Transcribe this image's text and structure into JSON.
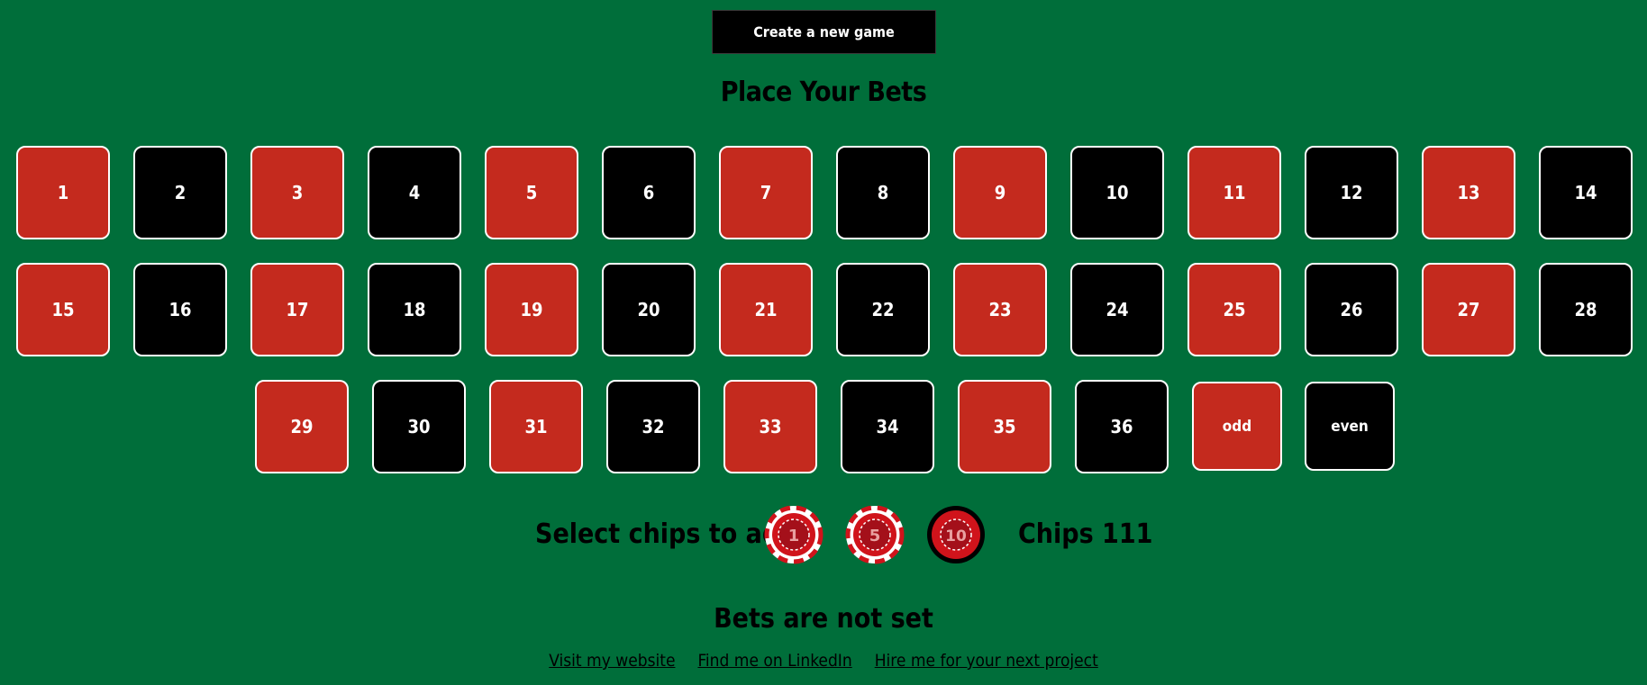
{
  "header": {
    "new_game_label": "Create a new game",
    "title": "Place Your Bets"
  },
  "colors": {
    "table_green": "#006e3a",
    "red": "#c42a1e",
    "black": "#000000",
    "border": "#ffffff"
  },
  "board": {
    "cells": [
      {
        "label": "1",
        "color": "red"
      },
      {
        "label": "2",
        "color": "black"
      },
      {
        "label": "3",
        "color": "red"
      },
      {
        "label": "4",
        "color": "black"
      },
      {
        "label": "5",
        "color": "red"
      },
      {
        "label": "6",
        "color": "black"
      },
      {
        "label": "7",
        "color": "red"
      },
      {
        "label": "8",
        "color": "black"
      },
      {
        "label": "9",
        "color": "red"
      },
      {
        "label": "10",
        "color": "black"
      },
      {
        "label": "11",
        "color": "red"
      },
      {
        "label": "12",
        "color": "black"
      },
      {
        "label": "13",
        "color": "red"
      },
      {
        "label": "14",
        "color": "black"
      },
      {
        "label": "15",
        "color": "red"
      },
      {
        "label": "16",
        "color": "black"
      },
      {
        "label": "17",
        "color": "red"
      },
      {
        "label": "18",
        "color": "black"
      },
      {
        "label": "19",
        "color": "red"
      },
      {
        "label": "20",
        "color": "black"
      },
      {
        "label": "21",
        "color": "red"
      },
      {
        "label": "22",
        "color": "black"
      },
      {
        "label": "23",
        "color": "red"
      },
      {
        "label": "24",
        "color": "black"
      },
      {
        "label": "25",
        "color": "red"
      },
      {
        "label": "26",
        "color": "black"
      },
      {
        "label": "27",
        "color": "red"
      },
      {
        "label": "28",
        "color": "black"
      },
      {
        "label": "29",
        "color": "red"
      },
      {
        "label": "30",
        "color": "black"
      },
      {
        "label": "31",
        "color": "red"
      },
      {
        "label": "32",
        "color": "black"
      },
      {
        "label": "33",
        "color": "red"
      },
      {
        "label": "34",
        "color": "black"
      },
      {
        "label": "35",
        "color": "red"
      },
      {
        "label": "36",
        "color": "black"
      },
      {
        "label": "odd",
        "color": "red"
      },
      {
        "label": "even",
        "color": "black"
      }
    ]
  },
  "chips": {
    "label": "Select chips to add",
    "options": [
      {
        "value": "1",
        "icon": "chip-icon"
      },
      {
        "value": "5",
        "icon": "chip-icon"
      },
      {
        "value": "10",
        "icon": "chip-icon"
      }
    ],
    "total_label": "Chips 111"
  },
  "status": {
    "bets": "Bets are not set"
  },
  "footer": {
    "links": [
      {
        "label": "Visit my website"
      },
      {
        "label": "Find me on LinkedIn"
      },
      {
        "label": "Hire me for your next project"
      }
    ]
  }
}
